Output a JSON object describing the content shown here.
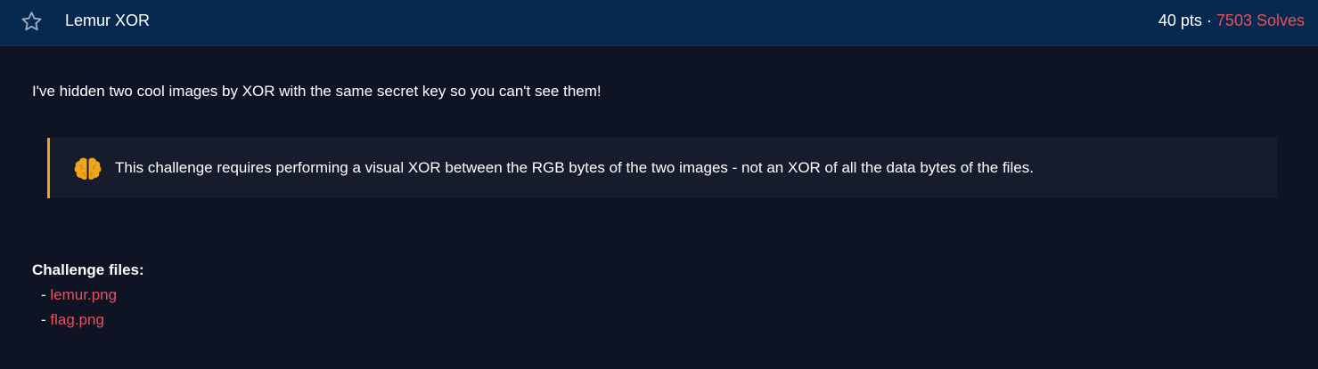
{
  "challenge": {
    "title": "Lemur XOR",
    "points": "40 pts",
    "separator": "·",
    "solves": "7503 Solves",
    "description": "I've hidden two cool images by XOR with the same secret key so you can't see them!",
    "hint": {
      "icon": "brain-icon",
      "text": "This challenge requires performing a visual XOR between the RGB bytes of the two images - not an XOR of all the data bytes of the files."
    },
    "files_heading": "Challenge files:",
    "files": [
      {
        "bullet": "-",
        "name": "lemur.png"
      },
      {
        "bullet": "-",
        "name": "flag.png"
      }
    ]
  },
  "colors": {
    "background": "#0f1425",
    "header": "#062a4f",
    "accent_red": "#e8505b",
    "hint_border": "#f0a51e",
    "hint_bg": "#161c2c"
  },
  "icons": {
    "favorite": "star-icon",
    "hint": "brain-icon"
  }
}
